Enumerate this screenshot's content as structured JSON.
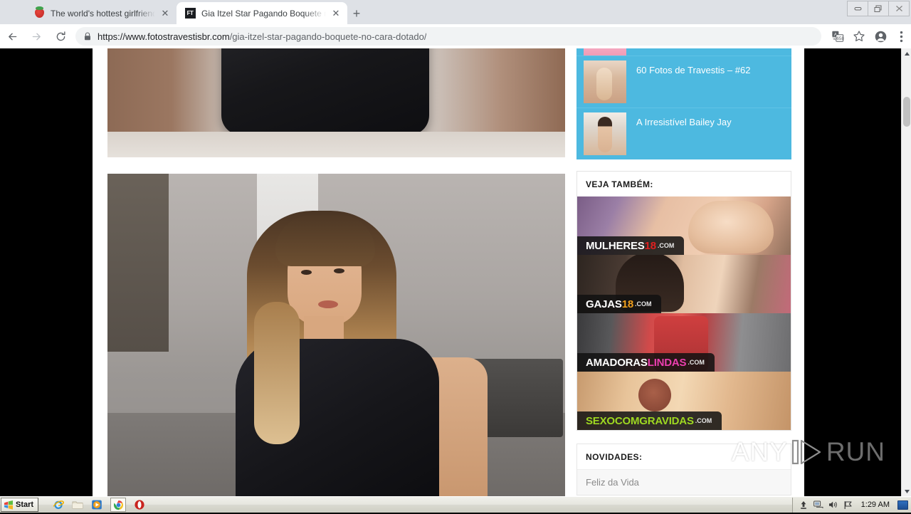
{
  "browser": {
    "tabs": [
      {
        "title": "The world's hottest girlfriend porn on",
        "favicon": "strawberry-icon",
        "active": false
      },
      {
        "title": "Gia Itzel Star Pagando Boquete no C",
        "favicon": "ft-site-icon",
        "active": true
      }
    ],
    "new_tab_label": "+",
    "close_label": "✕",
    "window_controls": {
      "minimize": "–",
      "restore": "❐",
      "close": "✕"
    },
    "nav": {
      "back": "←",
      "forward": "→",
      "reload": "⟳"
    },
    "omnibox": {
      "scheme": "https://www.fotostravestisbr.com",
      "path": "/gia-itzel-star-pagando-boquete-no-cara-dotado/",
      "lock": "lock-icon"
    },
    "toolbar_icons": [
      "translate-icon",
      "bookmark-star-icon",
      "profile-avatar-icon",
      "three-dot-menu-icon"
    ]
  },
  "sidebar": {
    "blue_widget": {
      "items": [
        {
          "title": "",
          "thumb": "thumb-c"
        },
        {
          "title": "60 Fotos de Travestis – #62",
          "thumb": "thumb-a"
        },
        {
          "title": "A Irresistível Bailey Jay",
          "thumb": "thumb-b"
        }
      ]
    },
    "veja_tambem": {
      "heading": "VEJA TAMBÉM:",
      "ads": [
        {
          "name_part1": "MULHERES",
          "name_part2": "18",
          "suffix": ".COM",
          "color1": "#ffffff",
          "color2": "#e02020"
        },
        {
          "name_part1": "GAJAS",
          "name_part2": "18",
          "suffix": ".COM",
          "color1": "#ffffff",
          "color2": "#f0a01e"
        },
        {
          "name_part1": "AMADORAS",
          "name_part2": "LINDAS",
          "suffix": ".COM",
          "color1": "#ffffff",
          "color2": "#ec3fb0"
        },
        {
          "name_part1": "SEXOCOM",
          "name_part2": "GRAVIDAS",
          "suffix": ".COM",
          "color1": "#9ed821",
          "color2": "#9ed821"
        }
      ]
    },
    "novidades": {
      "heading": "NOVIDADES:",
      "items": [
        "Feliz da Vida"
      ]
    }
  },
  "watermark": {
    "part1": "ANY",
    "part2": "RUN",
    "logo": "play-triangle-icon"
  },
  "scrollbar": {
    "up": "▲",
    "down": "▼"
  },
  "taskbar": {
    "start_label": "Start",
    "quick_launch": [
      "internet-explorer-icon",
      "file-explorer-icon",
      "media-player-icon",
      "chrome-icon",
      "opera-icon"
    ],
    "tray_icons": [
      "safely-remove-icon",
      "network-icon",
      "volume-icon",
      "flag-icon"
    ],
    "clock": "1:29 AM",
    "show_desktop": "show-desktop-icon"
  }
}
